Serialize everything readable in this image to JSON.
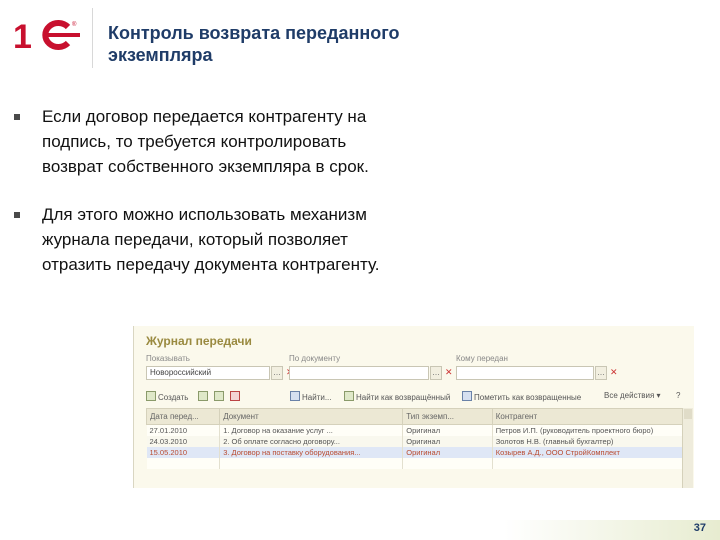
{
  "slide": {
    "title_line1": "Контроль возврата переданного",
    "title_line2": "экземпляра",
    "bullets": [
      {
        "lines": [
          "Если договор передается контрагенту на",
          "подпись, то требуется контролировать",
          "возврат собственного экземпляра в срок."
        ]
      },
      {
        "lines": [
          "Для этого можно использовать механизм",
          "журнала передачи, который позволяет",
          "отразить передачу документа контрагенту."
        ]
      }
    ],
    "page_number": "37",
    "accent_color": "#1f3c68",
    "logo_color": "#c8102e"
  },
  "window": {
    "title": "Журнал передачи",
    "filters": [
      {
        "label": "Показывать",
        "value": "Новороссийский"
      },
      {
        "label": "По документу",
        "value": ""
      },
      {
        "label": "Кому передан",
        "value": ""
      }
    ],
    "toolbar": {
      "create": "Создать",
      "find": "Найти...",
      "set_returned": "Найти как возвращённый",
      "mark_returned": "Пометить как возвращенные",
      "all_actions": "Все действия"
    },
    "columns": [
      "Дата перед...",
      "Документ",
      "Тип экземп...",
      "Контрагент"
    ],
    "rows": [
      {
        "date": "27.01.2010",
        "document": "1. Договор на оказание услуг ...",
        "type": "Оригинал",
        "counterparty": "Петров И.П. (руководитель проектного бюро)"
      },
      {
        "date": "24.03.2010",
        "document": "2. Об оплате согласно договору...",
        "type": "Оригинал",
        "counterparty": "Золотов Н.В. (главный бухгалтер)"
      },
      {
        "date": "15.05.2010",
        "document": "3. Договор на поставку оборудования...",
        "type": "Оригинал",
        "counterparty": "Козырев А.Д., ООО СтройКомплект"
      }
    ]
  }
}
